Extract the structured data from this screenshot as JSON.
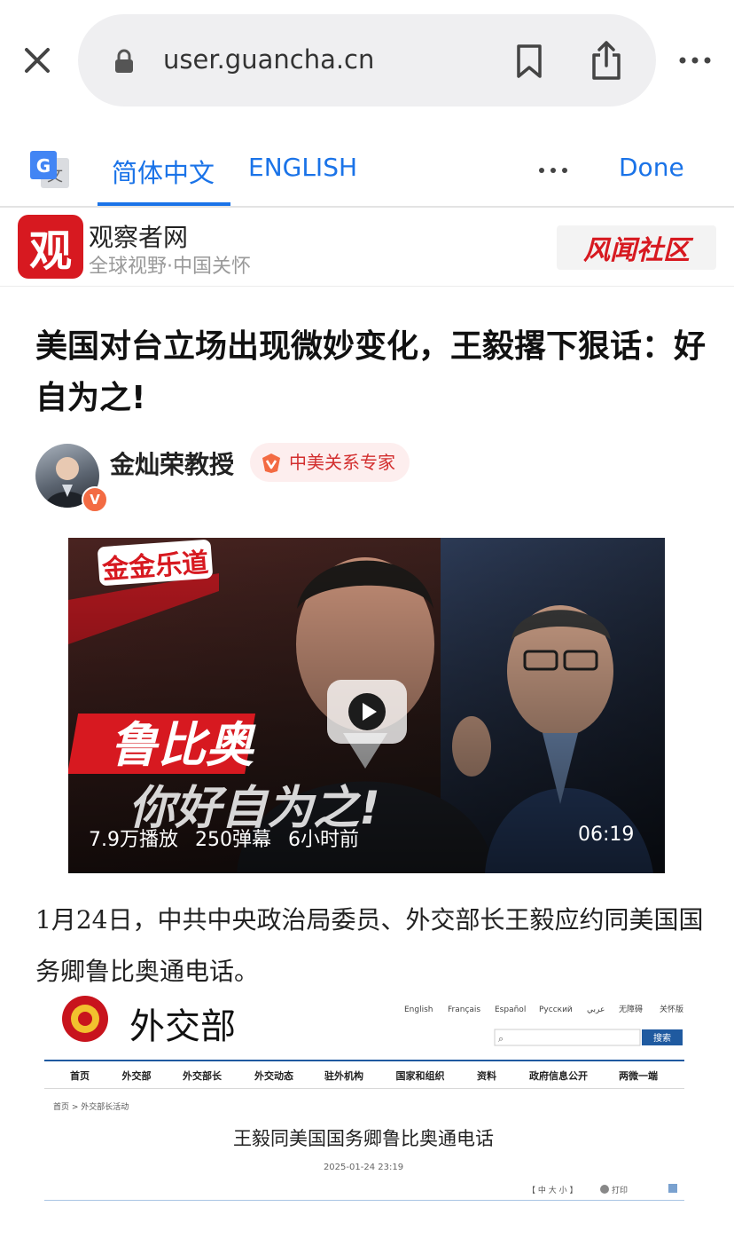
{
  "browser": {
    "url": "user.guancha.cn"
  },
  "translate_bar": {
    "tab_chinese": "简体中文",
    "tab_english": "ENGLISH",
    "done": "Done"
  },
  "site": {
    "logo_char": "观",
    "name": "观察者网",
    "slogan": "全球视野·中国关怀",
    "right_logo": "风闻社区"
  },
  "article": {
    "title": "美国对台立场出现微妙变化，王毅撂下狠话：好自为之!",
    "author": "金灿荣教授",
    "author_tag": "中美关系专家",
    "verified_badge": "V",
    "paragraph": "1月24日，中共中央政治局委员、外交部长王毅应约同美国国务卿鲁比奥通电话。"
  },
  "video": {
    "brand_caption": "金金乐道",
    "headline_1": "鲁比奥",
    "headline_2": "你好自为之!",
    "stats": "7.9万播放 250弹幕 6小时前",
    "duration": "06:19"
  },
  "embedded": {
    "ministry_logo": "外交部",
    "languages": [
      "English",
      "Français",
      "Español",
      "Русский",
      "عربي",
      "无障碍",
      "关怀版"
    ],
    "search_button": "搜索",
    "nav": [
      "首页",
      "外交部",
      "外交部长",
      "外交动态",
      "驻外机构",
      "国家和组织",
      "资料",
      "政府信息公开",
      "两微一端"
    ],
    "breadcrumb": "首页 > 外交部长活动",
    "headline": "王毅同美国国务卿鲁比奥通电话",
    "date": "2025-01-24 23:19",
    "font_size_ctrl": "【 中 大 小 】",
    "print": "打印"
  }
}
